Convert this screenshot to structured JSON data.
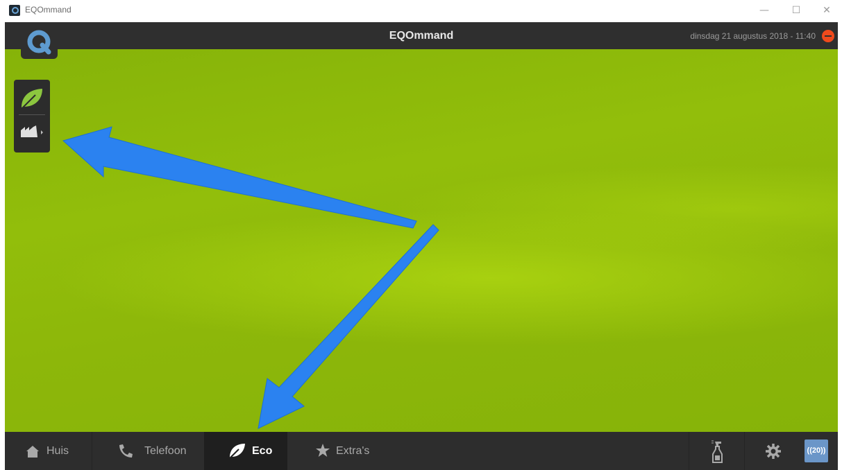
{
  "window": {
    "title": "EQOmmand",
    "minimize": "—",
    "maximize": "☐",
    "close": "✕"
  },
  "app": {
    "title": "EQOmmand",
    "datetime": "dinsdag 21 augustus 2018 - 11:40"
  },
  "side_panel": {
    "items": [
      {
        "icon": "leaf-icon"
      },
      {
        "icon": "factory-icon"
      }
    ]
  },
  "nav": {
    "tabs": [
      {
        "label": "Huis",
        "icon": "home-icon"
      },
      {
        "label": "Telefoon",
        "icon": "phone-icon"
      },
      {
        "label": "Eco",
        "icon": "leaf-icon",
        "active": true
      },
      {
        "label": "Extra's",
        "icon": "star-icon"
      }
    ],
    "tools": {
      "spray_icon": "spray-bottle-icon",
      "settings_icon": "gear-icon",
      "badge": "((20))"
    }
  },
  "colors": {
    "accent_arrow": "#2b82f0",
    "background": "#8db70a",
    "bar": "#2f2f2f",
    "stop": "#f04a1c"
  }
}
